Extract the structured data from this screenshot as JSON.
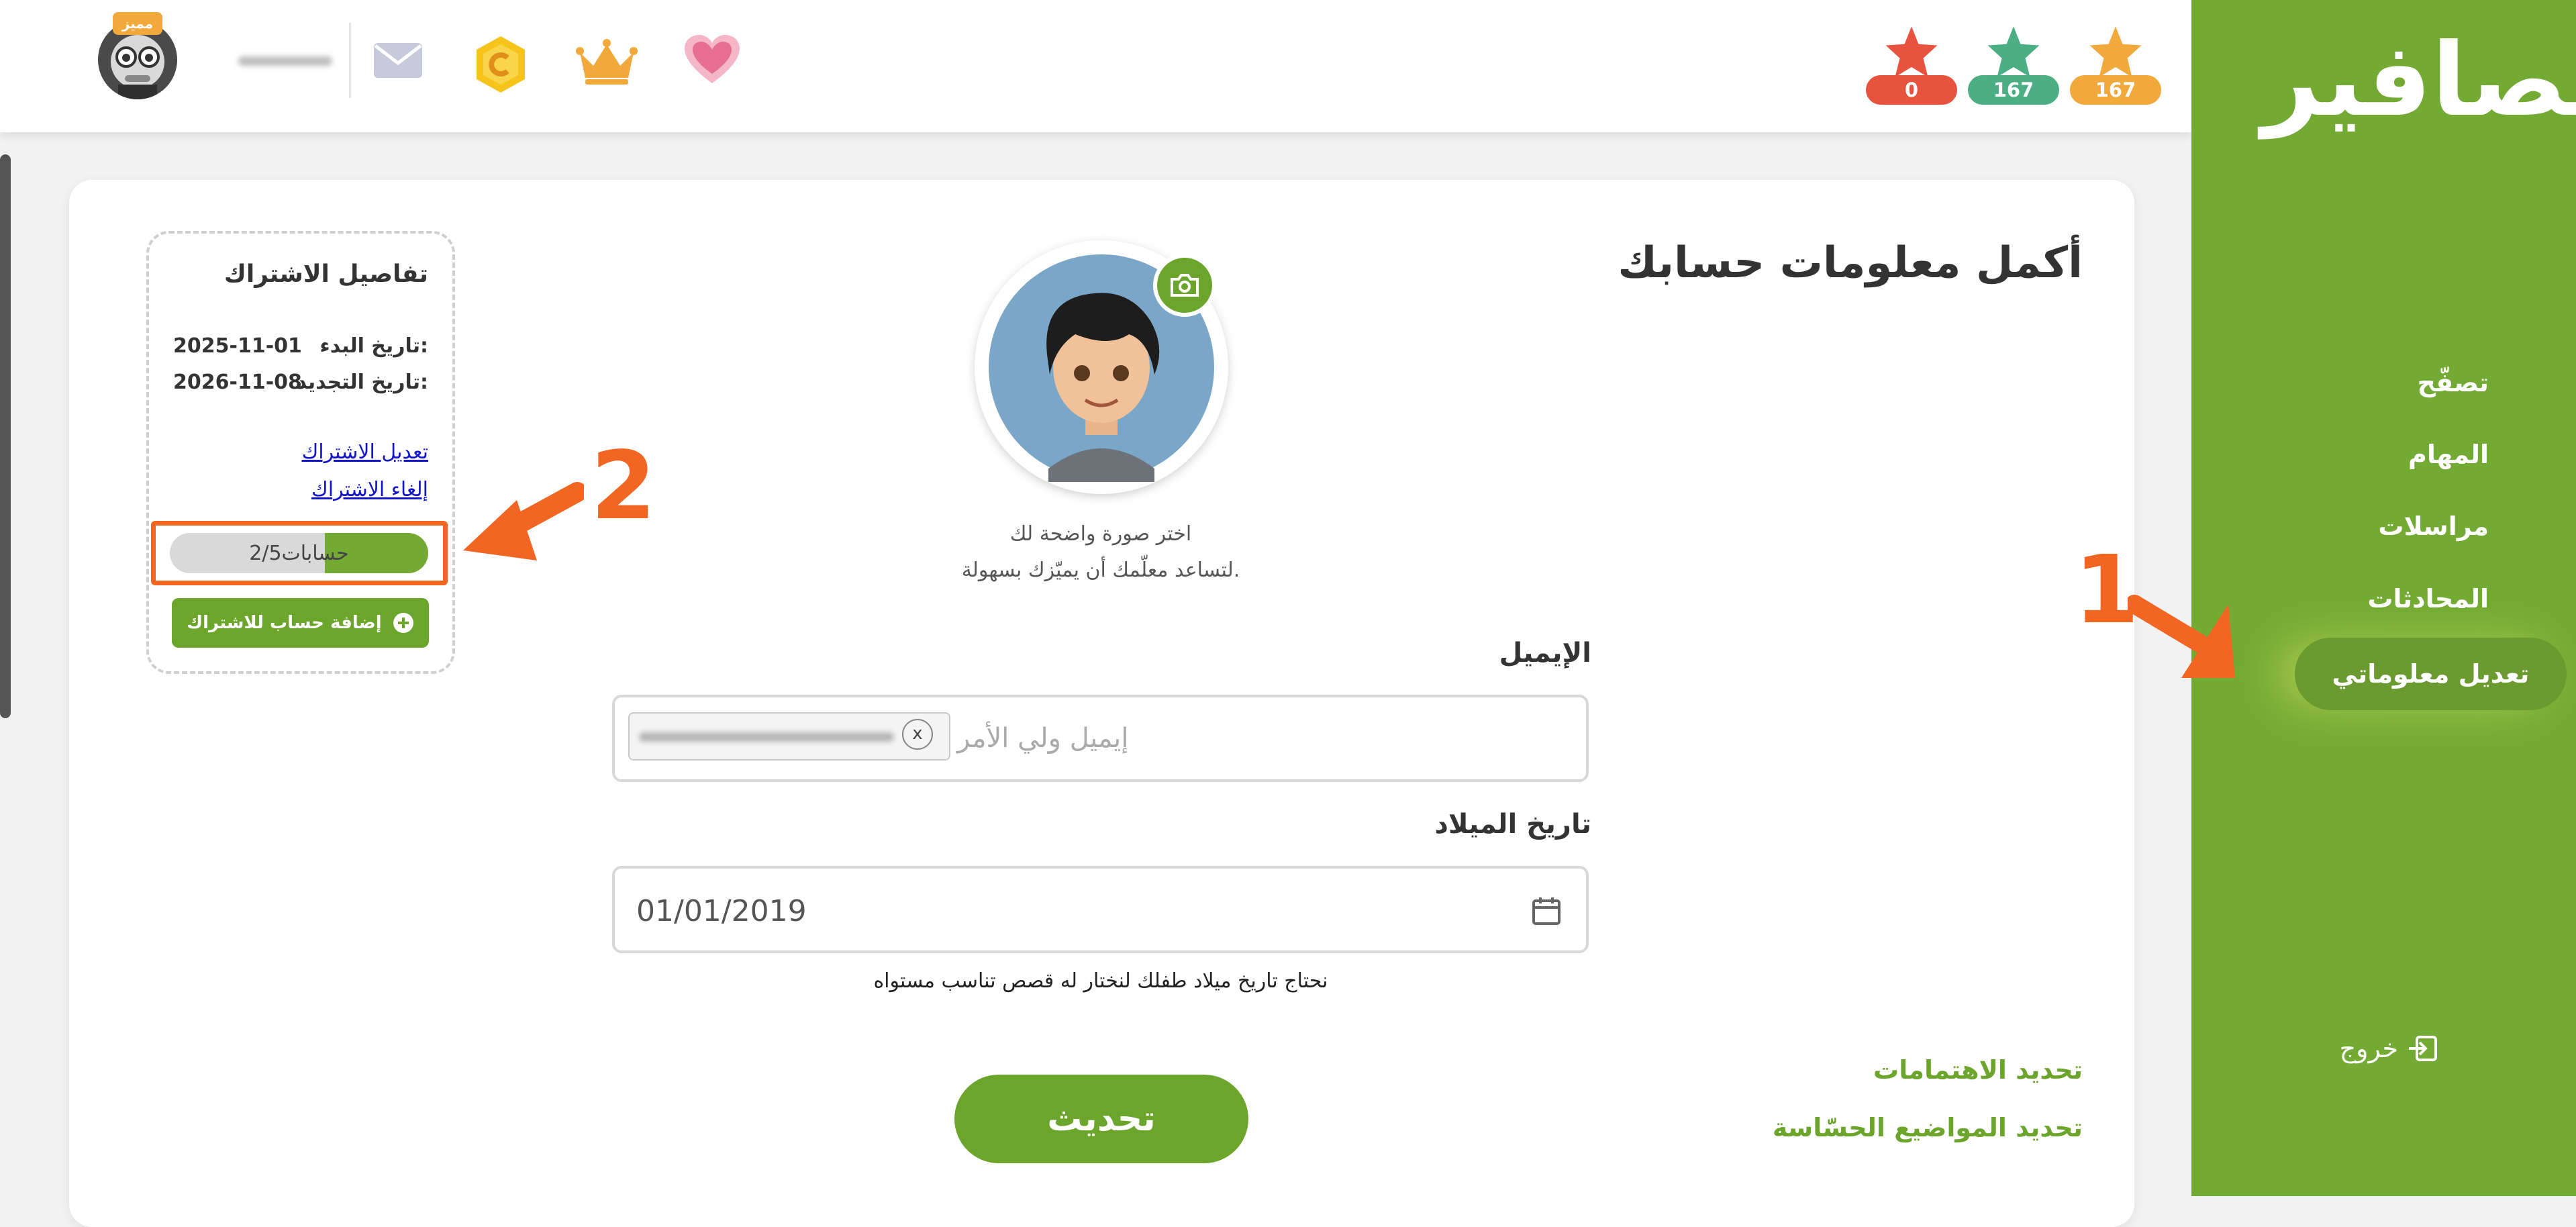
{
  "sidebar": {
    "logo": "عصافير",
    "items": [
      {
        "label": "تصفّح"
      },
      {
        "label": "المهام"
      },
      {
        "label": "مراسلات"
      },
      {
        "label": "المحادثات"
      },
      {
        "label": "تعديل معلوماتي",
        "active": true
      }
    ],
    "logout_label": "خروج"
  },
  "topbar": {
    "stars": [
      {
        "count": "0",
        "color": "#e8533f"
      },
      {
        "count": "167",
        "color": "#4caf84"
      },
      {
        "count": "167",
        "color": "#f2a93b"
      }
    ],
    "avatar_badge": "مميز",
    "icons": [
      "heart-icon",
      "crown-icon",
      "coin-icon",
      "mail-icon"
    ]
  },
  "main": {
    "title": "أكمل معلومات حسابك",
    "photo_hint_line1": "اختر صورة واضحة لك",
    "photo_hint_line2": "لتساعد معلّمك أن يميّزك بسهولة.",
    "email_label": "الإيميل",
    "email_placeholder": "إيميل ولي الأمر",
    "email_chip_remove": "x",
    "birthdate_label": "تاريخ الميلاد",
    "birthdate_value": "01/01/2019",
    "birthdate_hint": "نحتاج تاريخ ميلاد طفلك لنختار له قصص تناسب مستواه",
    "interests_link": "تحديد الاهتمامات",
    "sensitive_link": "تحديد المواضيع الحسّاسة",
    "update_button": "تحديث"
  },
  "subscription": {
    "title": "تفاصيل الاشتراك",
    "start_label": "تاريخ البدء:",
    "start_value": "2025-11-01",
    "renew_label": "تاريخ التجديد:",
    "renew_value": "2026-11-08",
    "edit_link": "تعديل الاشتراك",
    "cancel_link": "إلغاء الاشتراك",
    "accounts_used": 2,
    "accounts_total": 5,
    "accounts_text": "2/5",
    "accounts_word": "حسابات",
    "add_account_button": "إضافة حساب للاشتراك"
  },
  "annotations": {
    "one": "1",
    "two": "2",
    "accent": "#f26522"
  },
  "colors": {
    "brand_green": "#73aa33",
    "button_green": "#6ba52b"
  }
}
